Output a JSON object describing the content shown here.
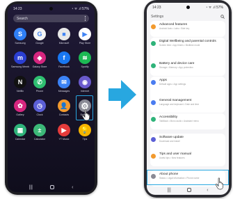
{
  "left_phone": {
    "status_time": "14:23",
    "status_icons": "◔ ᯤ .ıl 57%",
    "search_placeholder": "Search",
    "apps": [
      {
        "label": "Samsung",
        "color": "#2f7ff6",
        "icon": "samsung-icon",
        "glyph": "S"
      },
      {
        "label": "Google",
        "color": "#f5f5f5",
        "icon": "google-icon",
        "glyph": "G"
      },
      {
        "label": "Microsoft",
        "color": "#e8e8e8",
        "icon": "microsoft-icon",
        "glyph": "■"
      },
      {
        "label": "Play Store",
        "color": "#ffffff",
        "icon": "play-store-icon",
        "glyph": "▶"
      },
      {
        "label": "Samsung Members",
        "color": "#2b3fd1",
        "icon": "members-icon",
        "glyph": "m"
      },
      {
        "label": "Galaxy Store",
        "color": "#d6267f",
        "icon": "galaxy-store-icon",
        "glyph": "◆"
      },
      {
        "label": "Facebook",
        "color": "#1877f2",
        "icon": "facebook-icon",
        "glyph": "f"
      },
      {
        "label": "Spotify",
        "color": "#1db954",
        "icon": "spotify-icon",
        "glyph": "≋"
      },
      {
        "label": "Netflix",
        "color": "#111111",
        "icon": "netflix-icon",
        "glyph": "N"
      },
      {
        "label": "Phone",
        "color": "#2fbf71",
        "icon": "phone-icon",
        "glyph": "✆"
      },
      {
        "label": "Messages",
        "color": "#3b82f6",
        "icon": "messages-icon",
        "glyph": "✉"
      },
      {
        "label": "Internet",
        "color": "#6a5acd",
        "icon": "internet-icon",
        "glyph": "◉"
      },
      {
        "label": "Gallery",
        "color": "#d6267f",
        "icon": "gallery-icon",
        "glyph": "✿"
      },
      {
        "label": "Clock",
        "color": "#5b5fd6",
        "icon": "clock-icon",
        "glyph": "◷"
      },
      {
        "label": "Contacts",
        "color": "#f29a2e",
        "icon": "contacts-icon",
        "glyph": "👤"
      },
      {
        "label": "Settings",
        "color": "#8a8a95",
        "icon": "gear-icon",
        "glyph": "⚙"
      },
      {
        "label": "Calendar",
        "color": "#2fb37a",
        "icon": "calendar-icon",
        "glyph": "▦"
      },
      {
        "label": "Calculator",
        "color": "#3cb878",
        "icon": "calculator-icon",
        "glyph": "±"
      },
      {
        "label": "YT Music",
        "color": "#e43b3b",
        "icon": "yt-music-icon",
        "glyph": "▶"
      },
      {
        "label": "Tips",
        "color": "#f5b400",
        "icon": "tips-icon",
        "glyph": "💡"
      }
    ],
    "nav": {
      "recent": "|||",
      "home": "",
      "back": "‹"
    }
  },
  "right_phone": {
    "status_time": "14:23",
    "status_icons": "◔ ᯤ .ıl 57%",
    "title": "Settings",
    "items": [
      {
        "title": "Advanced features",
        "sub": "Android Auto • Labs • Side key",
        "color": "#f29a2e"
      },
      {
        "title": "Digital Wellbeing and parental controls",
        "sub": "Screen time • App timers • Bedtime mode",
        "color": "#2fb37a"
      },
      {
        "title": "Battery and device care",
        "sub": "Storage • Memory • App protection",
        "color": "#2fb37a"
      },
      {
        "title": "Apps",
        "sub": "Default apps • App settings",
        "color": "#4a7cf0"
      },
      {
        "title": "General management",
        "sub": "Language and keyboard • Date and time",
        "color": "#4a7cf0"
      },
      {
        "title": "Accessibility",
        "sub": "TalkBack • Mono audio • Assistant menu",
        "color": "#2fb37a"
      },
      {
        "title": "Software update",
        "sub": "Download and install",
        "color": "#5b5fd6"
      },
      {
        "title": "Tips and user manual",
        "sub": "Useful tips • New features",
        "color": "#f29a2e"
      },
      {
        "title": "About phone",
        "sub": "Status • Legal information • Phone name",
        "color": "#8a8a95"
      }
    ],
    "colors": {
      "highlight": "#28a7e0"
    }
  },
  "arrow": {
    "color": "#28a7e0"
  }
}
